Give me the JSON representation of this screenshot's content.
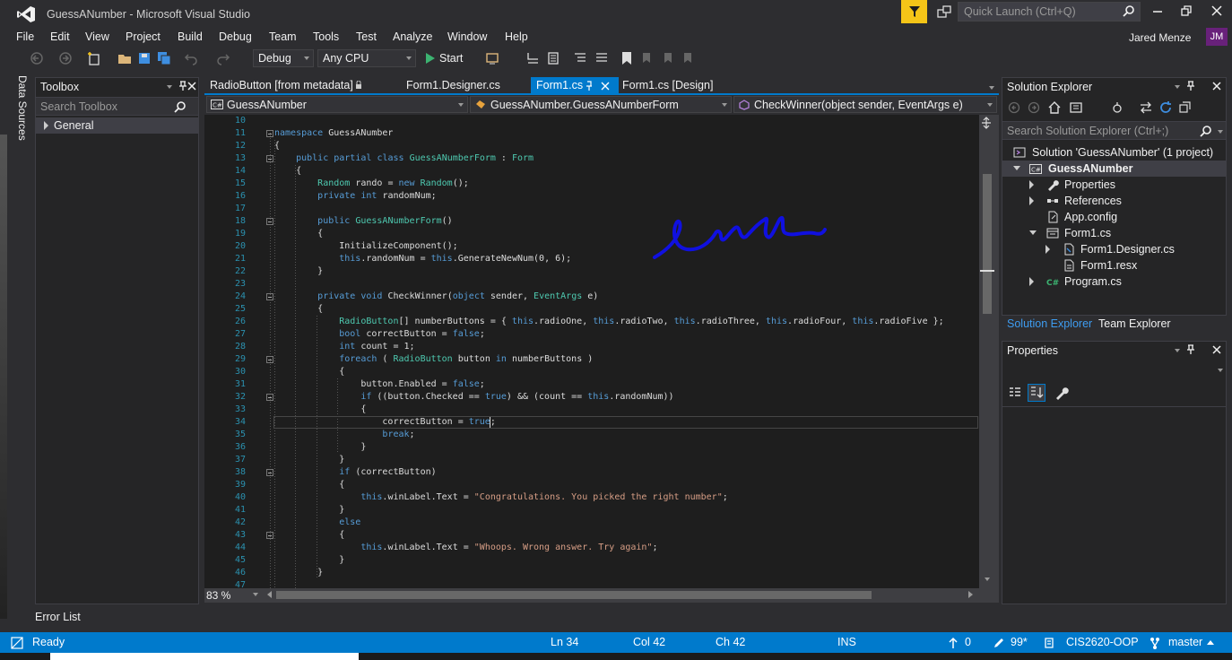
{
  "window": {
    "title": "GuessANumber - Microsoft Visual Studio",
    "quick_launch_placeholder": "Quick Launch (Ctrl+Q)",
    "user_name": "Jared Menze",
    "user_initials": "JM"
  },
  "menu": [
    "File",
    "Edit",
    "View",
    "Project",
    "Build",
    "Debug",
    "Team",
    "Tools",
    "Test",
    "Analyze",
    "Window",
    "Help"
  ],
  "toolbar": {
    "configuration": "Debug",
    "platform": "Any CPU",
    "start_label": "Start"
  },
  "left_strip": {
    "data_sources_label": "Data Sources"
  },
  "toolbox": {
    "title": "Toolbox",
    "search_placeholder": "Search Toolbox",
    "group_label": "General"
  },
  "editor": {
    "tabs": [
      {
        "label": "RadioButton [from metadata]"
      },
      {
        "label": "Form1.Designer.cs"
      },
      {
        "label": "Form1.cs",
        "active": true
      },
      {
        "label": "Form1.cs [Design]"
      }
    ],
    "nav": {
      "project": "GuessANumber",
      "class": "GuessANumber.GuessANumberForm",
      "member": "CheckWinner(object sender, EventArgs e)"
    },
    "zoom": "83 %",
    "lines": [
      {
        "n": "10",
        "text": ""
      },
      {
        "n": "11",
        "text": "namespace GuessANumber"
      },
      {
        "n": "12",
        "text": "{"
      },
      {
        "n": "13",
        "text": "    public partial class GuessANumberForm : Form"
      },
      {
        "n": "14",
        "text": "    {"
      },
      {
        "n": "15",
        "text": "        Random rando = new Random();"
      },
      {
        "n": "16",
        "text": "        private int randomNum;"
      },
      {
        "n": "17",
        "text": ""
      },
      {
        "n": "18",
        "text": "        public GuessANumberForm()"
      },
      {
        "n": "19",
        "text": "        {"
      },
      {
        "n": "20",
        "text": "            InitializeComponent();"
      },
      {
        "n": "21",
        "text": "            this.randomNum = this.GenerateNewNum(0, 6);"
      },
      {
        "n": "22",
        "text": "        }"
      },
      {
        "n": "23",
        "text": ""
      },
      {
        "n": "24",
        "text": "        private void CheckWinner(object sender, EventArgs e)"
      },
      {
        "n": "25",
        "text": "        {"
      },
      {
        "n": "26",
        "text": "            RadioButton[] numberButtons = { this.radioOne, this.radioTwo, this.radioThree, this.radioFour, this.radioFive };"
      },
      {
        "n": "27",
        "text": "            bool correctButton = false;"
      },
      {
        "n": "28",
        "text": "            int count = 1;"
      },
      {
        "n": "29",
        "text": "            foreach ( RadioButton button in numberButtons )"
      },
      {
        "n": "30",
        "text": "            {"
      },
      {
        "n": "31",
        "text": "                button.Enabled = false;"
      },
      {
        "n": "32",
        "text": "                if ((button.Checked == true) && (count == this.randomNum))"
      },
      {
        "n": "33",
        "text": "                {"
      },
      {
        "n": "34",
        "text": "                    correctButton = true;"
      },
      {
        "n": "35",
        "text": "                    break;"
      },
      {
        "n": "36",
        "text": "                }"
      },
      {
        "n": "37",
        "text": "            }"
      },
      {
        "n": "38",
        "text": "            if (correctButton)"
      },
      {
        "n": "39",
        "text": "            {"
      },
      {
        "n": "40",
        "text": "                this.winLabel.Text = \"Congratulations. You picked the right number\";"
      },
      {
        "n": "41",
        "text": "            }"
      },
      {
        "n": "42",
        "text": "            else"
      },
      {
        "n": "43",
        "text": "            {"
      },
      {
        "n": "44",
        "text": "                this.winLabel.Text = \"Whoops. Wrong answer. Try again\";"
      },
      {
        "n": "45",
        "text": "            }"
      },
      {
        "n": "46",
        "text": "        }"
      },
      {
        "n": "47",
        "text": ""
      }
    ]
  },
  "solution_explorer": {
    "title": "Solution Explorer",
    "search_placeholder": "Search Solution Explorer (Ctrl+;)",
    "tree": [
      {
        "label": "Solution 'GuessANumber' (1 project)",
        "icon": "solution-icon"
      },
      {
        "label": "GuessANumber",
        "icon": "csharp-project-icon",
        "bold": true,
        "selected": true
      },
      {
        "label": "Properties",
        "icon": "wrench-icon"
      },
      {
        "label": "References",
        "icon": "references-icon"
      },
      {
        "label": "App.config",
        "icon": "config-file-icon"
      },
      {
        "label": "Form1.cs",
        "icon": "form-icon"
      },
      {
        "label": "Form1.Designer.cs",
        "icon": "cs-file-icon"
      },
      {
        "label": "Form1.resx",
        "icon": "resx-file-icon"
      },
      {
        "label": "Program.cs",
        "icon": "csharp-file-icon"
      }
    ],
    "tabs": [
      "Solution Explorer",
      "Team Explorer"
    ]
  },
  "properties": {
    "title": "Properties"
  },
  "bottom": {
    "error_list": "Error List"
  },
  "status": {
    "ready": "Ready",
    "line": "Ln 34",
    "col": "Col 42",
    "ch": "Ch 42",
    "mode": "INS",
    "up_count": "0",
    "pending": "99*",
    "repo": "CIS2620-OOP",
    "branch": "master"
  },
  "colors": {
    "accent": "#007acc",
    "background": "#2d2d30",
    "editor_bg": "#1e1e1e",
    "keyword": "#569cd6",
    "type": "#4ec9b0",
    "string": "#d69d85",
    "line_number": "#2b91af",
    "ink": "#1010e0"
  }
}
